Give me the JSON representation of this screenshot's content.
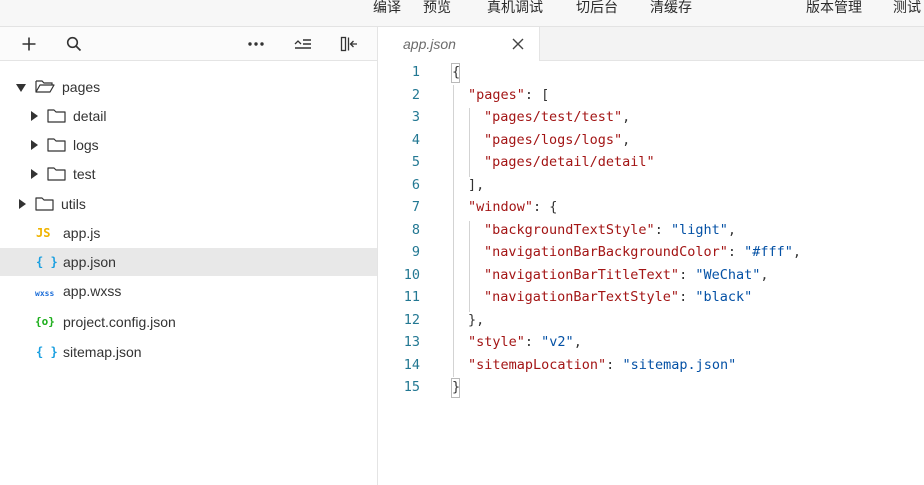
{
  "toolbar": {
    "items": [
      {
        "label": "编译"
      },
      {
        "label": "预览"
      },
      {
        "label": "真机调试"
      },
      {
        "label": "切后台"
      },
      {
        "label": "清缓存"
      },
      {
        "label": "版本管理"
      },
      {
        "label": "测试"
      }
    ]
  },
  "explorer": {
    "toolbar_icons": [
      "add-icon",
      "search-icon",
      "more-icon",
      "collapse-list-icon",
      "layout-toggle-icon"
    ],
    "tree": [
      {
        "name": "pages",
        "type": "folder",
        "expanded": true,
        "depth": 0
      },
      {
        "name": "detail",
        "type": "folder",
        "expanded": false,
        "depth": 1
      },
      {
        "name": "logs",
        "type": "folder",
        "expanded": false,
        "depth": 1
      },
      {
        "name": "test",
        "type": "folder",
        "expanded": false,
        "depth": 1
      },
      {
        "name": "utils",
        "type": "folder",
        "expanded": false,
        "depth": 0
      },
      {
        "name": "app.js",
        "type": "file",
        "icon_text": "JS",
        "icon_color": "#f0b400",
        "depth": 0
      },
      {
        "name": "app.json",
        "type": "file",
        "icon_text": "{ }",
        "icon_color": "#1a9fe0",
        "depth": 0,
        "selected": true
      },
      {
        "name": "app.wxss",
        "type": "file",
        "icon_text": "wxss",
        "icon_color": "#1e6fd9",
        "depth": 0
      },
      {
        "name": "project.config.json",
        "type": "file",
        "icon_text": "{o}",
        "icon_color": "#1aad19",
        "depth": 0
      },
      {
        "name": "sitemap.json",
        "type": "file",
        "icon_text": "{ }",
        "icon_color": "#1a9fe0",
        "depth": 0
      }
    ]
  },
  "editor": {
    "tab": {
      "title": "app.json"
    },
    "lines": [
      [
        [
          "p",
          "{"
        ]
      ],
      [
        [
          "k",
          "\"pages\""
        ],
        [
          "p",
          ": ["
        ]
      ],
      [
        [
          "k",
          "\"pages/test/test\""
        ],
        [
          "p",
          ","
        ]
      ],
      [
        [
          "k",
          "\"pages/logs/logs\""
        ],
        [
          "p",
          ","
        ]
      ],
      [
        [
          "k",
          "\"pages/detail/detail\""
        ]
      ],
      [
        [
          "p",
          "],"
        ]
      ],
      [
        [
          "k",
          "\"window\""
        ],
        [
          "p",
          ": {"
        ]
      ],
      [
        [
          "k",
          "\"backgroundTextStyle\""
        ],
        [
          "p",
          ": "
        ],
        [
          "s",
          "\"light\""
        ],
        [
          "p",
          ","
        ]
      ],
      [
        [
          "k",
          "\"navigationBarBackgroundColor\""
        ],
        [
          "p",
          ": "
        ],
        [
          "s",
          "\"#fff\""
        ],
        [
          "p",
          ","
        ]
      ],
      [
        [
          "k",
          "\"navigationBarTitleText\""
        ],
        [
          "p",
          ": "
        ],
        [
          "s",
          "\"WeChat\""
        ],
        [
          "p",
          ","
        ]
      ],
      [
        [
          "k",
          "\"navigationBarTextStyle\""
        ],
        [
          "p",
          ": "
        ],
        [
          "s",
          "\"black\""
        ]
      ],
      [
        [
          "p",
          "},"
        ]
      ],
      [
        [
          "k",
          "\"style\""
        ],
        [
          "p",
          ": "
        ],
        [
          "s",
          "\"v2\""
        ],
        [
          "p",
          ","
        ]
      ],
      [
        [
          "k",
          "\"sitemapLocation\""
        ],
        [
          "p",
          ": "
        ],
        [
          "s",
          "\"sitemap.json\""
        ]
      ],
      [
        [
          "p",
          "}"
        ]
      ]
    ],
    "line_numbers": [
      "1",
      "2",
      "3",
      "4",
      "5",
      "6",
      "7",
      "8",
      "9",
      "10",
      "11",
      "12",
      "13",
      "14",
      "15"
    ]
  },
  "colors": {
    "key": "#a31515",
    "string": "#0451a5",
    "line_number": "#237893",
    "selection": "#e8e8e8"
  }
}
